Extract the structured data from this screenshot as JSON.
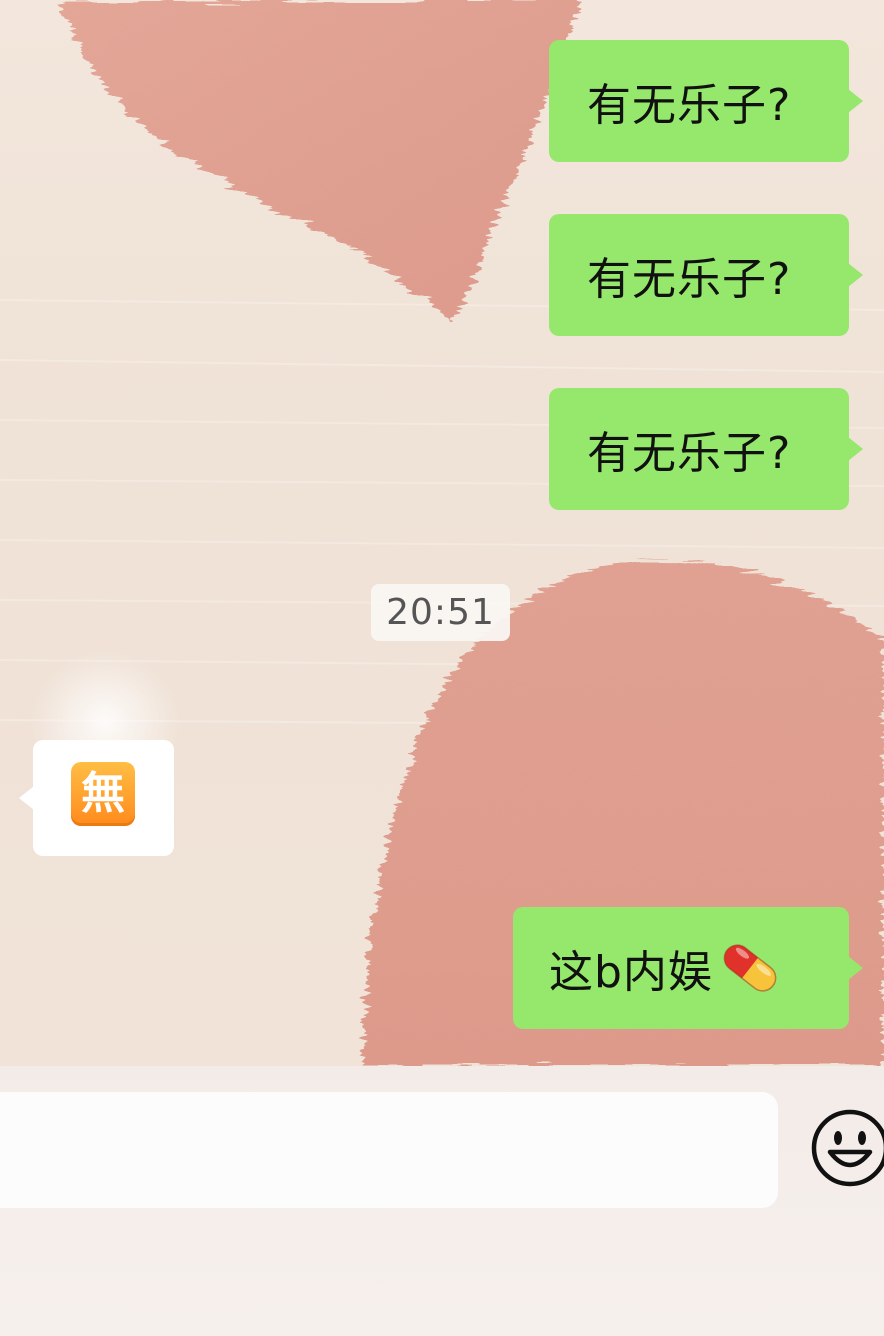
{
  "messages": {
    "outgoing_1": "有无乐子?",
    "outgoing_2": "有无乐子?",
    "outgoing_3": "有无乐子?",
    "timestamp": "20:51",
    "incoming_emoji_char": "無",
    "incoming_emoji_name": "japanese-free-of-charge-button",
    "outgoing_4_text": "这b内娱",
    "outgoing_4_emoji_name": "pill-icon"
  },
  "input": {
    "value": "",
    "placeholder": ""
  },
  "toolbar": {
    "emoji_button_icon": "smiley-face-icon"
  },
  "colors": {
    "outgoing_bubble": "#95e86b",
    "incoming_bubble": "#ffffff",
    "timestamp_text": "#555555",
    "wallpaper_blob": "#e1a293"
  }
}
